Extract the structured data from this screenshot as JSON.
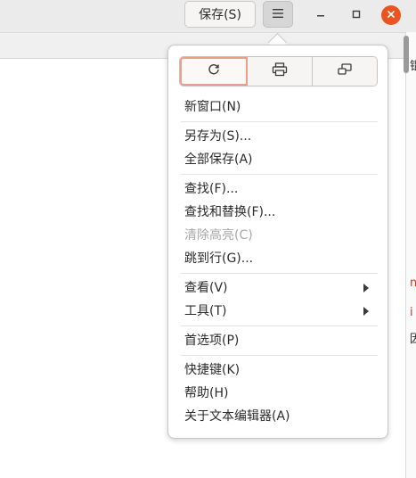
{
  "header": {
    "save_label": "保存(S)",
    "menu_icon": "hamburger-icon",
    "minimize_icon": "minimize-icon",
    "maximize_icon": "maximize-icon",
    "close_icon": "close-icon",
    "close_color": "#e95420"
  },
  "popover": {
    "toolbar": [
      {
        "icon": "reload-icon"
      },
      {
        "icon": "print-icon"
      },
      {
        "icon": "fullscreen-icon"
      }
    ],
    "items": [
      {
        "label": "新窗口(N)"
      },
      {
        "label": "另存为(S)..."
      },
      {
        "label": "全部保存(A)"
      },
      {
        "label": "查找(F)..."
      },
      {
        "label": "查找和替换(F)..."
      },
      {
        "label": "清除高亮(C)"
      },
      {
        "label": "跳到行(G)..."
      },
      {
        "label": "查看(V)"
      },
      {
        "label": "工具(T)"
      },
      {
        "label": "首选项(P)"
      },
      {
        "label": "快捷键(K)"
      },
      {
        "label": "帮助(H)"
      },
      {
        "label": "关于文本编辑器(A)"
      }
    ]
  },
  "edge_text": {
    "top": "锟",
    "mid1": "n",
    "mid2": "i",
    "mid3": "因"
  }
}
